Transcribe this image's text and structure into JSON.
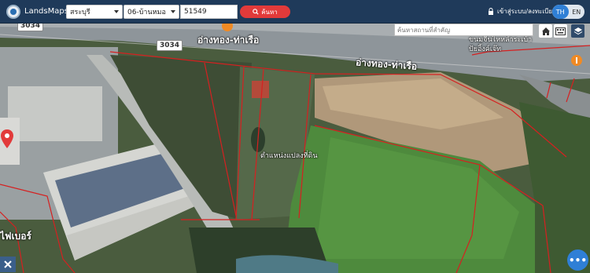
{
  "header": {
    "app_name": "LandsMaps",
    "province": "สระบุรี",
    "district": "06-บ้านหมอ",
    "parcel_number": "51549",
    "search_button": "ค้นหา",
    "login_label": "เข้าสู่ระบบ/ลงทะเบียน",
    "lang_th": "TH",
    "lang_en": "EN"
  },
  "map": {
    "place_search_placeholder": "ค้นหาสถานที่สำคัญ",
    "road_label_1": "อ่างทอง-ท่าเรือ",
    "road_label_2": "อ่างทอง-ท่าเรือ",
    "route_number": "3034",
    "route_number_top": "3034",
    "poi_label": "ขนมจีนไหหลำระเบ้าปัยอิ้งค์เจ๊ท",
    "pin_label": "ตำแหน่งแปลงที่ดิน",
    "place_label_bottom": "ไฟเบอร์",
    "fab_label": "•••"
  },
  "colors": {
    "topbar": "#1f3a5a",
    "search_button": "#e23a3a",
    "accent_blue": "#2f7fd6",
    "parcel_lines": "#d62020"
  },
  "icons": [
    "logo",
    "search-icon",
    "lock-icon",
    "home-icon",
    "keyboard-icon",
    "layers-icon",
    "map-pin-icon",
    "more-icon",
    "tools-icon",
    "restaurant-icon"
  ]
}
